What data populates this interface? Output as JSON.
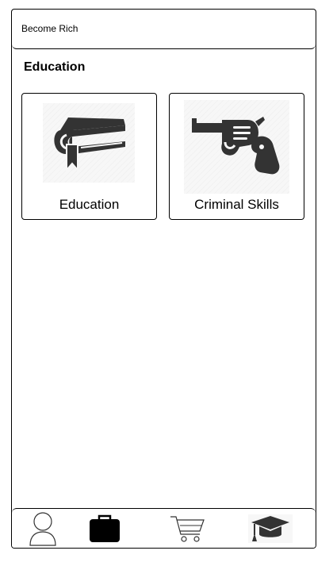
{
  "header": {
    "title": "Become Rich"
  },
  "section": {
    "title": "Education"
  },
  "cards": [
    {
      "label": "Education",
      "icon": "book-icon"
    },
    {
      "label": "Criminal Skills",
      "icon": "revolver-icon"
    }
  ],
  "bottom_nav": {
    "items": [
      {
        "icon": "user-icon"
      },
      {
        "icon": "briefcase-icon"
      },
      {
        "icon": "shopping-cart-icon"
      },
      {
        "icon": "graduation-cap-icon"
      }
    ]
  },
  "colors": {
    "border": "#000000",
    "icon_fill": "#333333",
    "background": "#ffffff"
  }
}
